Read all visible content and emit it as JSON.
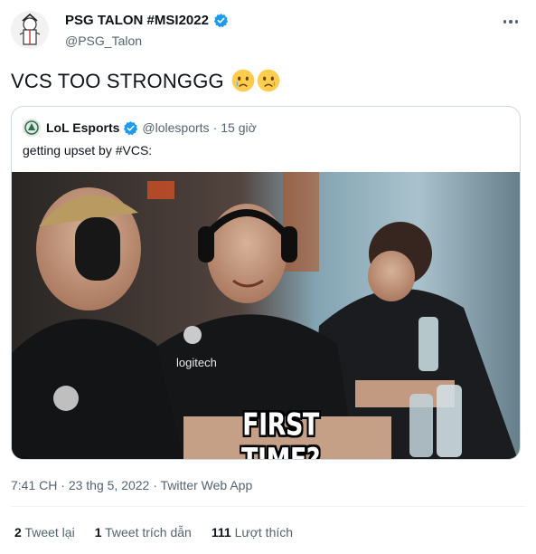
{
  "tweet": {
    "author_name": "PSG TALON #MSI2022",
    "author_handle": "@PSG_Talon",
    "text": "VCS TOO STRONGGG",
    "emoji": [
      "crying-face",
      "crying-face"
    ]
  },
  "quoted": {
    "author_name": "LoL Esports",
    "author_handle": "@lolesports",
    "separator": "·",
    "time": "15 giờ",
    "text": "getting upset by #VCS:",
    "image_caption": "FIRST TIME?"
  },
  "meta": {
    "time": "7:41 CH",
    "separator1": "·",
    "date": "23 thg 5, 2022",
    "separator2": "·",
    "app": "Twitter Web App"
  },
  "stats": [
    {
      "count": "2",
      "label": "Tweet lại"
    },
    {
      "count": "1",
      "label": "Tweet trích dẫn"
    },
    {
      "count": "111",
      "label": "Lượt thích"
    }
  ],
  "colors": {
    "verified": "#1d9bf0",
    "secondary_text": "#536471",
    "border": "#cfd9de"
  }
}
